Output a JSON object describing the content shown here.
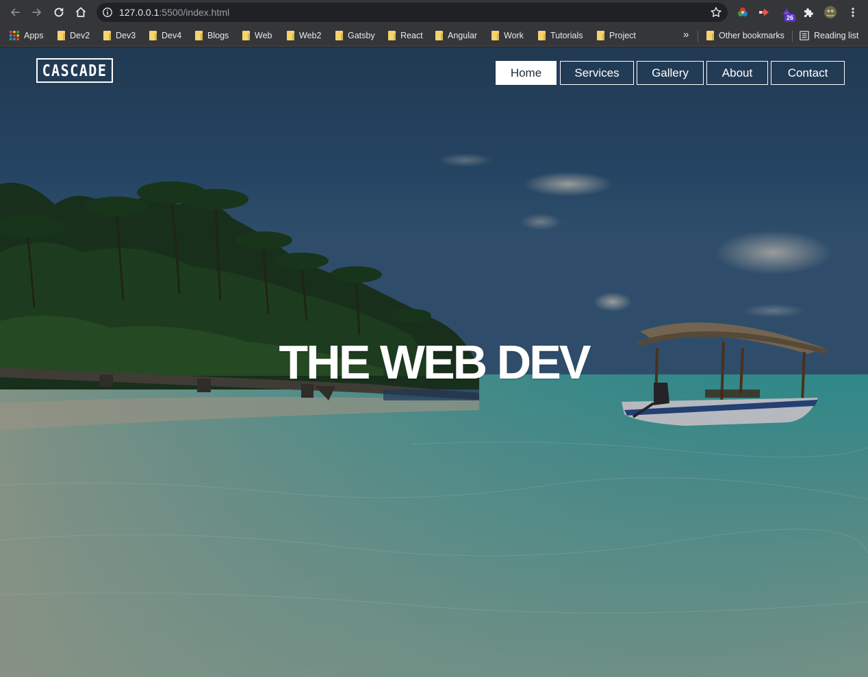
{
  "browser": {
    "url_host": "127.0.0.1",
    "url_rest": ":5500/index.html",
    "extension_badge": "26",
    "bookmarks": [
      {
        "label": "Apps",
        "icon": "apps-grid-icon"
      },
      {
        "label": "Dev2",
        "icon": "folder-icon"
      },
      {
        "label": "Dev3",
        "icon": "folder-icon"
      },
      {
        "label": "Dev4",
        "icon": "folder-icon"
      },
      {
        "label": "Blogs",
        "icon": "folder-icon"
      },
      {
        "label": "Web",
        "icon": "folder-icon"
      },
      {
        "label": "Web2",
        "icon": "folder-icon"
      },
      {
        "label": "Gatsby",
        "icon": "folder-icon"
      },
      {
        "label": "React",
        "icon": "folder-icon"
      },
      {
        "label": "Angular",
        "icon": "folder-icon"
      },
      {
        "label": "Work",
        "icon": "folder-icon"
      },
      {
        "label": "Tutorials",
        "icon": "folder-icon"
      },
      {
        "label": "Project",
        "icon": "folder-icon"
      }
    ],
    "overflow_label": "»",
    "other_bookmarks": "Other bookmarks",
    "reading_list": "Reading list"
  },
  "site": {
    "logo_text": "CASCADE",
    "nav": [
      {
        "label": "Home",
        "active": true
      },
      {
        "label": "Services",
        "active": false
      },
      {
        "label": "Gallery",
        "active": false
      },
      {
        "label": "About",
        "active": false
      },
      {
        "label": "Contact",
        "active": false
      }
    ],
    "headline": "THE WEB DEV"
  },
  "colors": {
    "chrome_toolbar": "#35363a",
    "omnibox": "#202124",
    "sky_top": "#2b4a6b",
    "sea": "#3fa6a3",
    "nav_active_text": "#1d2a38"
  }
}
